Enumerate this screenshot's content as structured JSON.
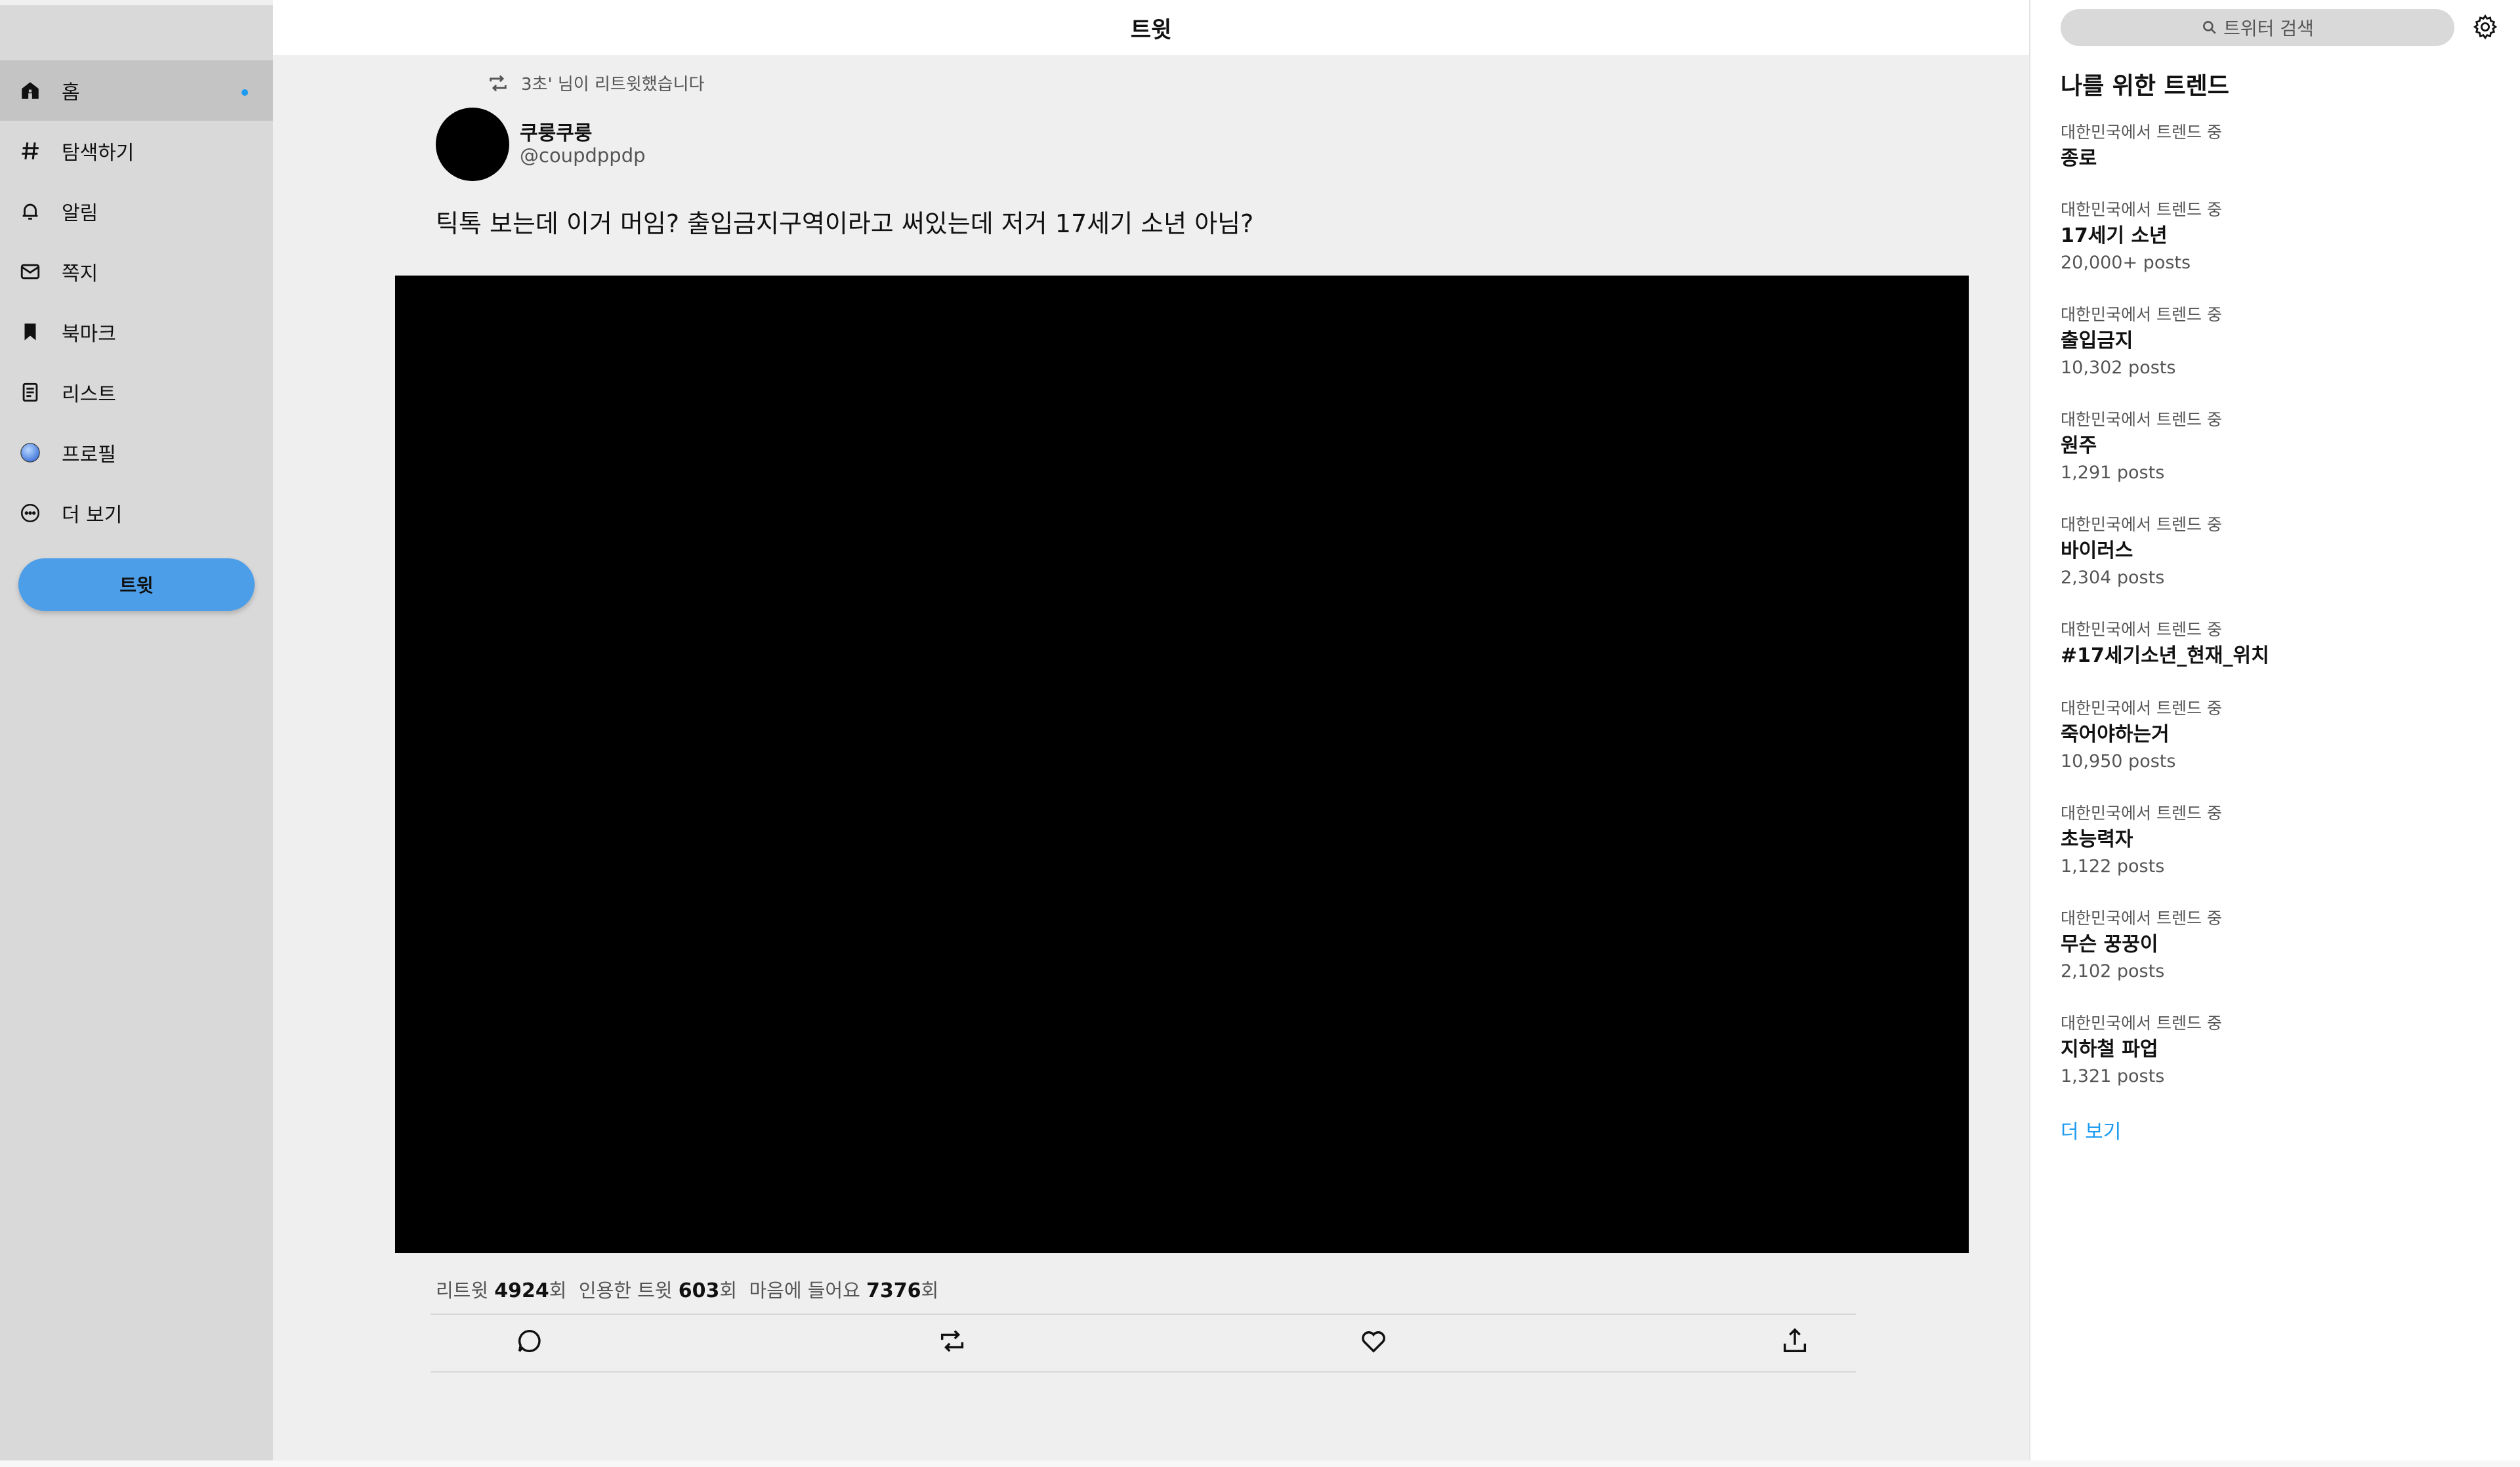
{
  "header": {
    "title": "트윗"
  },
  "sidebar": {
    "items": [
      {
        "label": "홈",
        "icon": "home-icon",
        "active": true
      },
      {
        "label": "탐색하기",
        "icon": "hashtag-icon"
      },
      {
        "label": "알림",
        "icon": "bell-icon"
      },
      {
        "label": "쪽지",
        "icon": "mail-icon"
      },
      {
        "label": "북마크",
        "icon": "bookmark-icon"
      },
      {
        "label": "리스트",
        "icon": "list-icon"
      },
      {
        "label": "프로필",
        "icon": "profile-icon"
      },
      {
        "label": "더 보기",
        "icon": "more-icon"
      }
    ],
    "tweet_button": "트윗"
  },
  "tweet": {
    "retweet_note": "3초' 님이 리트윗했습니다",
    "author_name": "쿠룽쿠룽",
    "author_handle": "@coupdppdp",
    "text": "틱톡 보는데 이거 머임? 출입금지구역이라고 써있는데 저거 17세기 소년 아님?",
    "stats": {
      "retweets_label": "리트윗",
      "retweets_value": "4924",
      "quotes_label": "인용한 트윗",
      "quotes_value": "603",
      "likes_label": "마음에 들어요",
      "likes_value": "7376",
      "unit": "회"
    },
    "actions": [
      "reply-icon",
      "retweet-icon",
      "like-icon",
      "share-icon"
    ]
  },
  "right": {
    "search_placeholder": "트위터 검색",
    "trends_title": "나를 위한 트렌드",
    "trends": [
      {
        "context": "대한민국에서 트렌드 중",
        "name": "종로",
        "count": ""
      },
      {
        "context": "대한민국에서 트렌드 중",
        "name": "17세기 소년",
        "count": "20,000+ posts"
      },
      {
        "context": "대한민국에서 트렌드 중",
        "name": "출입금지",
        "count": "10,302 posts"
      },
      {
        "context": "대한민국에서 트렌드 중",
        "name": "원주",
        "count": "1,291 posts"
      },
      {
        "context": "대한민국에서 트렌드 중",
        "name": "바이러스",
        "count": "2,304 posts"
      },
      {
        "context": "대한민국에서 트렌드 중",
        "name": "#17세기소년_현재_위치",
        "count": ""
      },
      {
        "context": "대한민국에서 트렌드 중",
        "name": "죽어야하는거",
        "count": "10,950 posts"
      },
      {
        "context": "대한민국에서 트렌드 중",
        "name": "초능력자",
        "count": "1,122 posts"
      },
      {
        "context": "대한민국에서 트렌드 중",
        "name": "무슨 꿍꿍이",
        "count": "2,102 posts"
      },
      {
        "context": "대한민국에서 트렌드 중",
        "name": "지하철 파업",
        "count": "1,321 posts"
      }
    ],
    "more_label": "더 보기"
  },
  "colors": {
    "accent": "#1d9bf0",
    "tweet_button": "#4c9ee8",
    "sidebar": "#d9d9d9",
    "media": "#000000"
  }
}
